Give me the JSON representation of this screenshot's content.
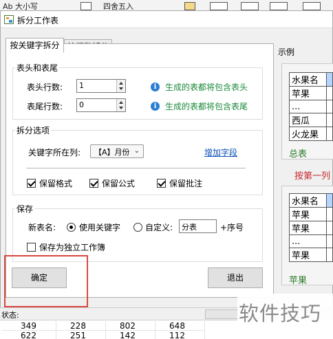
{
  "ribbon": {
    "font_label": "Ab 大小写",
    "round_label": "四舍五入"
  },
  "dialog": {
    "title": "拆分工作表",
    "tabs": [
      {
        "label": "按关键字拆分"
      },
      {
        "label": "按行数拆分"
      }
    ],
    "header_footer": {
      "title": "表头和表尾",
      "header_rows_label": "表头行数:",
      "header_rows_value": "1",
      "header_hint": "生成的表都将包含表头",
      "footer_rows_label": "表尾行数:",
      "footer_rows_value": "0",
      "footer_hint": "生成的表都将包含表尾"
    },
    "split_options": {
      "title": "拆分选项",
      "key_column_label": "关键字所在列:",
      "key_column_value": "【A】月份",
      "add_field_link": "增加字段",
      "keep_format": "保留格式",
      "keep_formula": "保留公式",
      "keep_comment": "保留批注"
    },
    "save": {
      "title": "保存",
      "new_name_label": "新表名:",
      "use_keyword_label": "使用关键字",
      "custom_label": "自定义:",
      "custom_value": "分表",
      "serial_suffix": "+序号",
      "save_as_workbook": "保存为独立工作簿"
    },
    "ok_button": "确定",
    "exit_button": "退出",
    "example": {
      "title": "示例",
      "top_table": [
        [
          "水果名",
          ""
        ],
        [
          "苹果",
          ""
        ],
        [
          "...",
          ""
        ],
        [
          "西瓜",
          ""
        ],
        [
          "火龙果",
          ""
        ]
      ],
      "top_sheet_tab": "总表",
      "note": "按第一列",
      "bottom_table": [
        [
          "水果名",
          ""
        ],
        [
          "苹果",
          ""
        ],
        [
          "苹果",
          ""
        ],
        [
          "...",
          ""
        ],
        [
          "苹果",
          ""
        ]
      ],
      "bottom_sheet_tab": "苹果"
    }
  },
  "status": {
    "label": "状态:"
  },
  "sheet_rows": [
    [
      "349",
      "228",
      "802",
      "648"
    ],
    [
      "622",
      "251",
      "142",
      "112"
    ]
  ],
  "watermark": "软件技巧"
}
